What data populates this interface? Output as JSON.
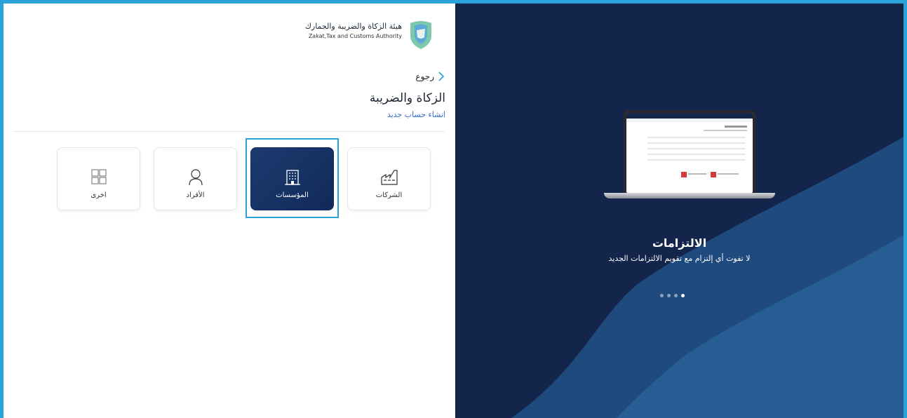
{
  "logo": {
    "arabic_name": "هيئة الزكاة والضريبة والجمارك",
    "english_name": "Zakat,Tax and Customs Authority",
    "icon": "zatca-emblem-icon"
  },
  "nav": {
    "back_label": "رجوع",
    "icon": "chevron-right-icon"
  },
  "section": {
    "title": "الزكاة والضريبة",
    "create_account_link": "انشاء حساب جديد"
  },
  "account_types": [
    {
      "label": "الشركات",
      "icon": "factory-icon",
      "selected": false
    },
    {
      "label": "المؤسسات",
      "icon": "building-icon",
      "selected": true
    },
    {
      "label": "الأفراد",
      "icon": "person-icon",
      "selected": false
    },
    {
      "label": "اخرى",
      "icon": "grid-icon",
      "selected": false
    }
  ],
  "carousel": {
    "title": "الالتزامات",
    "subtitle": "لا تفوت أي إلتزام مع تقويم الالتزامات الجديد",
    "dot_count": 4,
    "active_dot": 4
  },
  "colors": {
    "outer_frame": "#29a3d9",
    "navy_panel": "#13254a",
    "wave": "#1f4a7e",
    "selected_card": "#11295a",
    "link": "#2f6ccc",
    "highlight_outline": "#2ba0d8"
  }
}
